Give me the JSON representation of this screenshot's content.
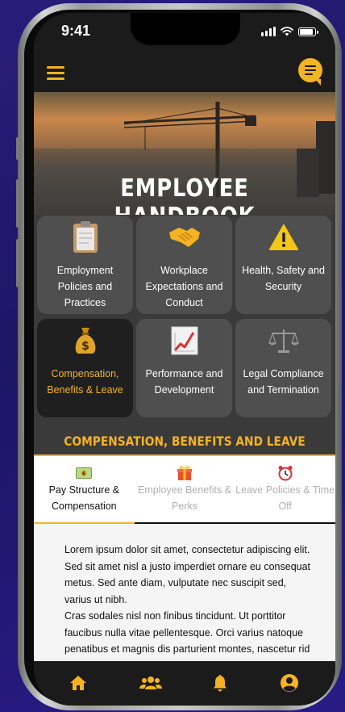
{
  "status_bar": {
    "time": "9:41"
  },
  "header": {
    "title": "EMPLOYEE HANDBOOK"
  },
  "categories": [
    {
      "icon": "clipboard-icon",
      "label": "Employment Policies and Practices",
      "active": false
    },
    {
      "icon": "handshake-icon",
      "label": "Workplace Expectations and Conduct",
      "active": false
    },
    {
      "icon": "warning-icon",
      "label": "Health, Safety and Security",
      "active": false
    },
    {
      "icon": "money-bag-icon",
      "label": "Compensation, Benefits & Leave",
      "active": true
    },
    {
      "icon": "chart-increasing-icon",
      "label": "Performance and Development",
      "active": false
    },
    {
      "icon": "scales-icon",
      "label": "Legal Compliance and Termination",
      "active": false
    }
  ],
  "section": {
    "title": "COMPENSATION, BENEFITS AND LEAVE",
    "tabs": [
      {
        "icon": "dollar-banknote-icon",
        "label": "Pay Structure & Compensation",
        "active": true
      },
      {
        "icon": "gift-icon",
        "label": "Employee Benefits & Perks",
        "active": false
      },
      {
        "icon": "alarm-clock-icon",
        "label": "Leave Policies & Time Off",
        "active": false
      }
    ],
    "body_paragraph_1": "Lorem ipsum dolor sit amet, consectetur adipiscing elit. Sed sit amet nisl a justo imperdiet ornare eu consequat metus. Sed ante diam, vulputate nec suscipit sed, varius ut nibh.",
    "body_paragraph_2": "Cras sodales nisl non finibus tincidunt. Ut porttitor faucibus nulla vitae pellentesque. Orci varius natoque penatibus et magnis dis parturient montes, nascetur rid"
  },
  "bottom_nav": [
    {
      "icon": "home-icon"
    },
    {
      "icon": "people-icon"
    },
    {
      "icon": "bell-icon"
    },
    {
      "icon": "user-circle-icon"
    }
  ],
  "colors": {
    "accent": "#f5b323",
    "dark": "#1b1b1b",
    "card": "#4f4f4f",
    "card_active": "#1f1f1f"
  }
}
